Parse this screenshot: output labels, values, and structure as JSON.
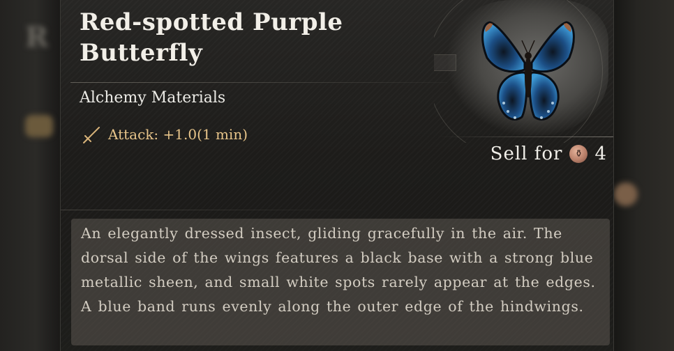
{
  "item": {
    "name": "Red-spotted Purple Butterfly",
    "category": "Alchemy Materials",
    "effect": "Attack: +1.0(1 min)",
    "sell_label": "Sell for",
    "sell_price": "4",
    "description": "An elegantly dressed insect, gliding gracefully in the air. The dorsal side of the wings features a black base with a strong blue metallic sheen, and small white spots rarely appear at the edges. A blue band runs evenly along the outer edge of the hindwings."
  },
  "icons": {
    "effect": "sword-icon",
    "currency": "coin-icon",
    "art": "butterfly-icon"
  },
  "colors": {
    "effect_text": "#e8c58a",
    "title": "#f2efe8",
    "wing_blue": "#2a78b8",
    "coin": "#b9806a"
  }
}
